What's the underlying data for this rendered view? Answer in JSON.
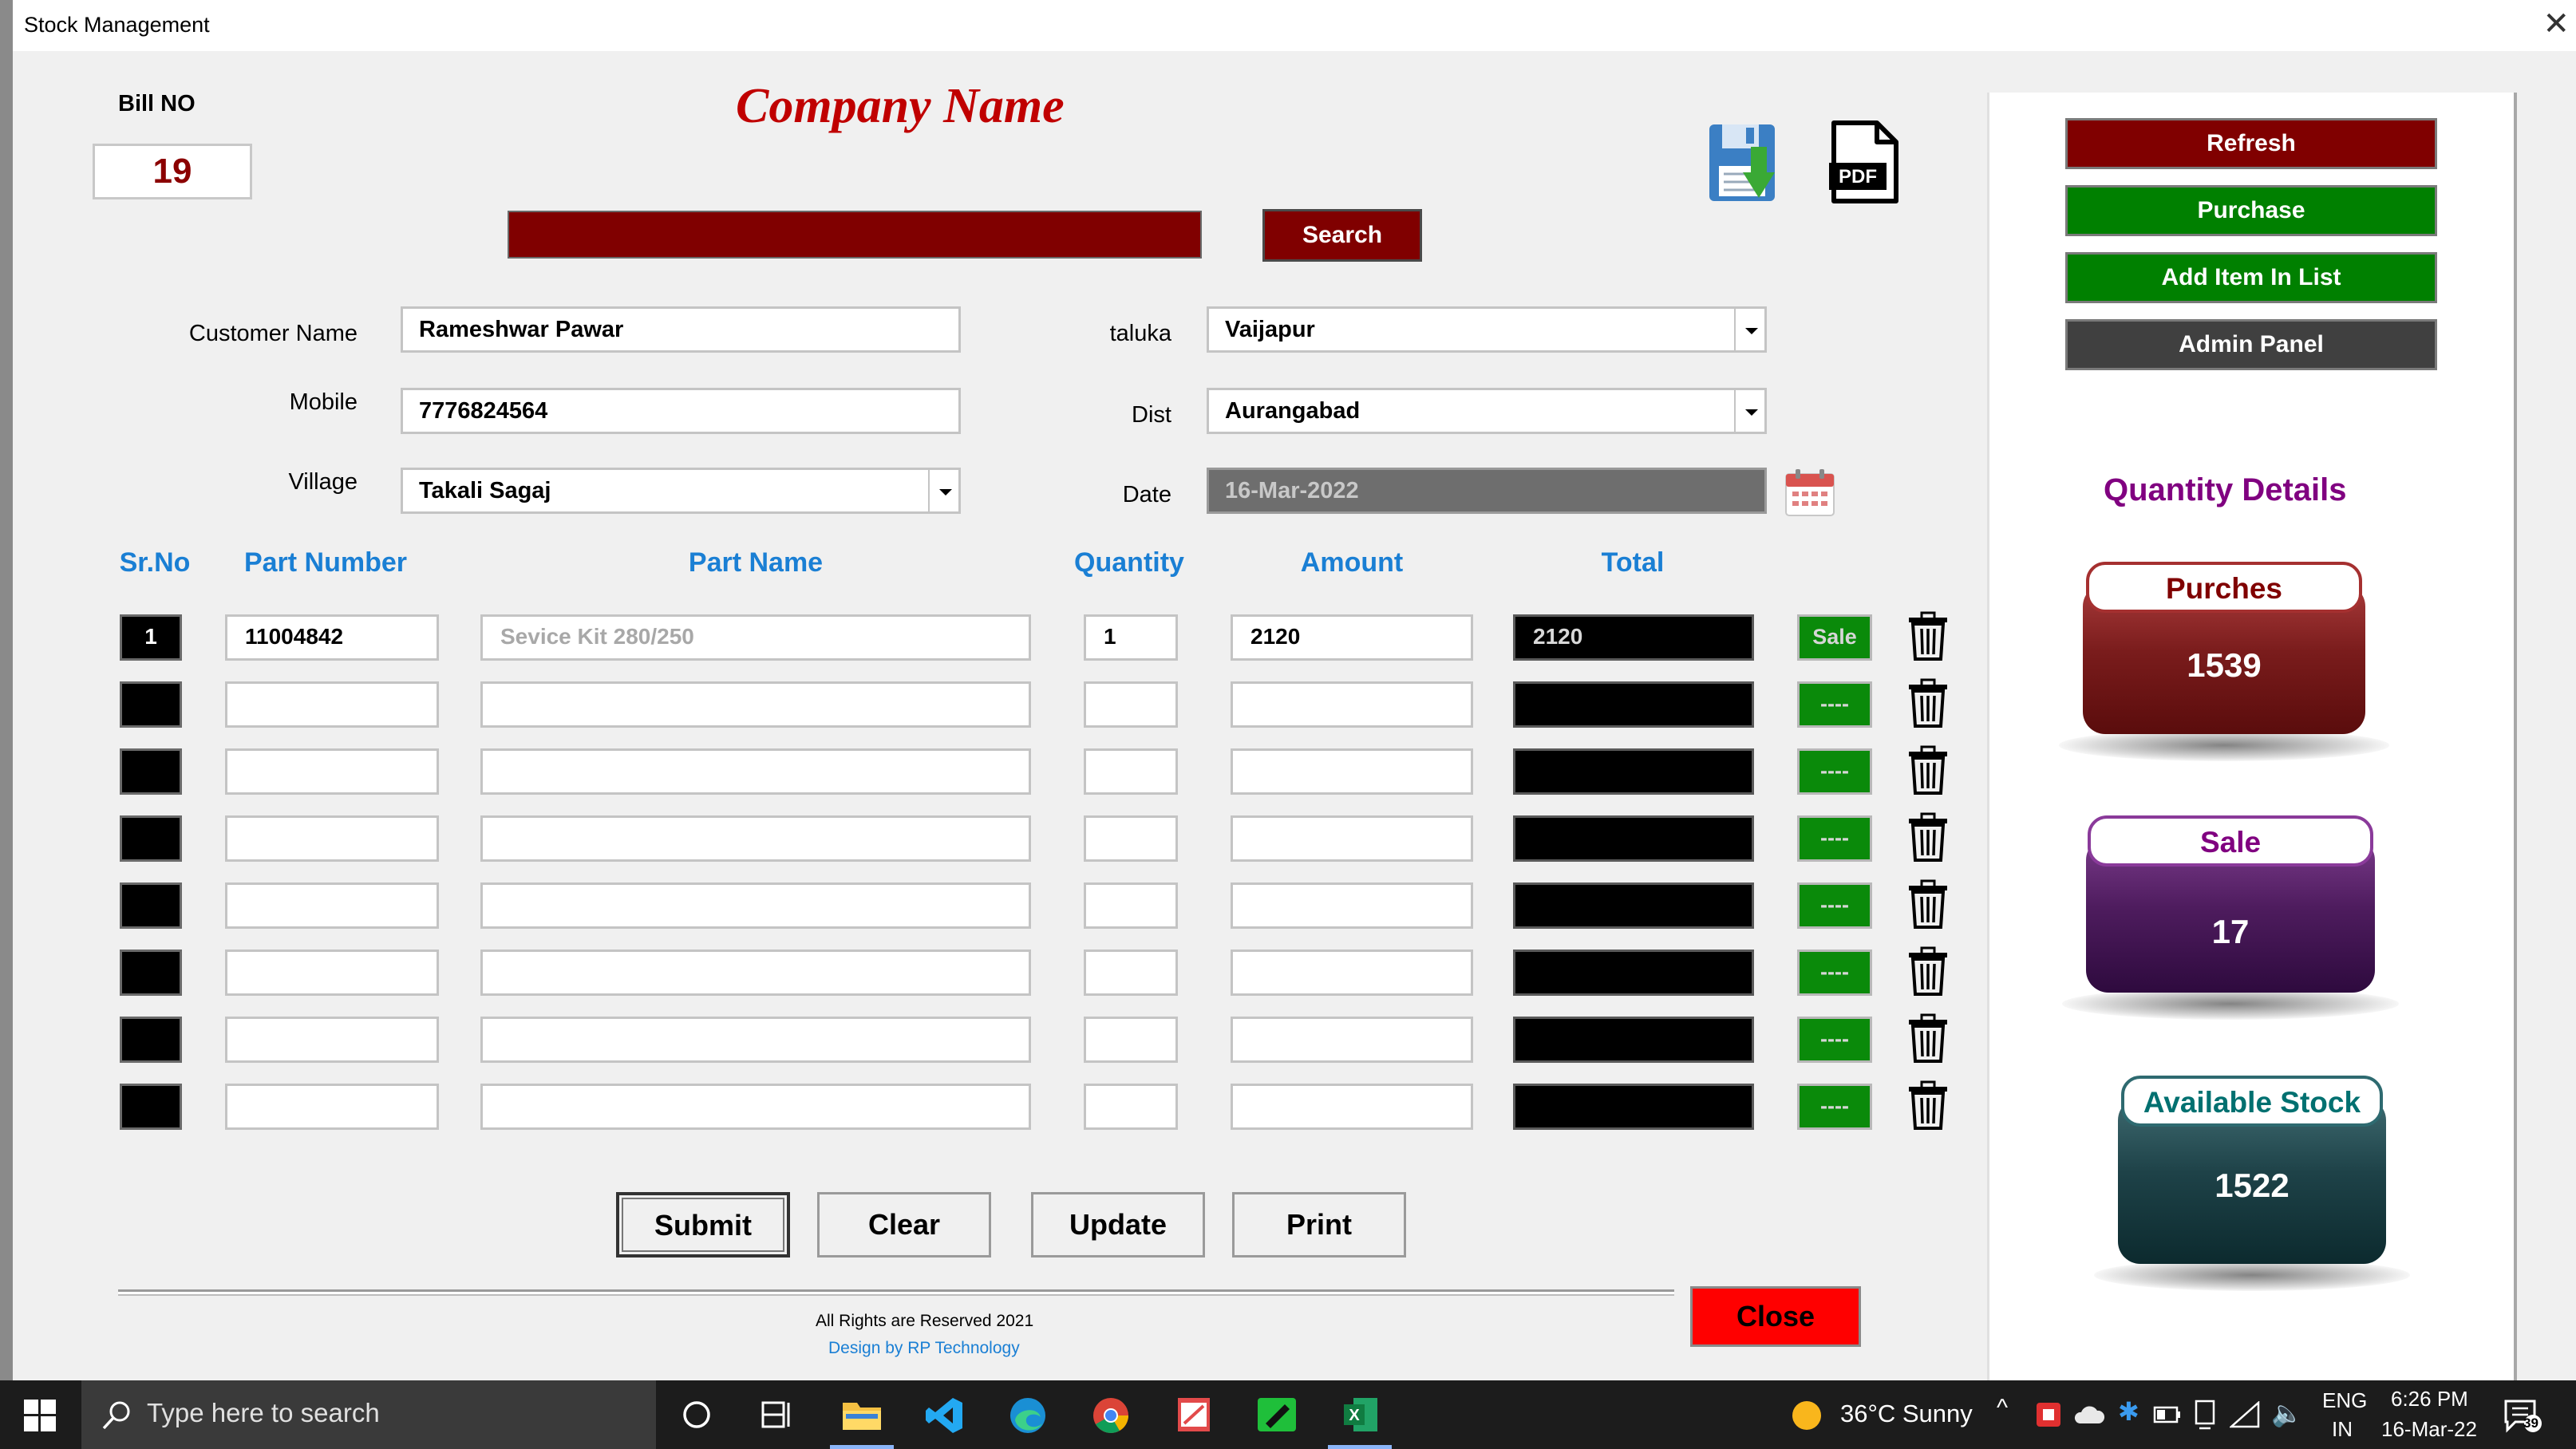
{
  "window": {
    "title": "Stock Management"
  },
  "bill": {
    "label": "Bill NO",
    "number": "19"
  },
  "company_name": "Company Name",
  "search": {
    "button": "Search",
    "value": ""
  },
  "form": {
    "customer_label": "Customer Name",
    "customer_value": "Rameshwar Pawar",
    "mobile_label": "Mobile",
    "mobile_value": "7776824564",
    "village_label": "Village",
    "village_value": "Takali Sagaj",
    "taluka_label": "taluka",
    "taluka_value": "Vaijapur",
    "dist_label": "Dist",
    "dist_value": "Aurangabad",
    "date_label": "Date",
    "date_value": "16-Mar-2022"
  },
  "table": {
    "headers": [
      "Sr.No",
      "Part Number",
      "Part Name",
      "Quantity",
      "Amount",
      "Total"
    ],
    "rows": [
      {
        "sr": "1",
        "part_number": "11004842",
        "part_name": "Sevice Kit 280/250",
        "quantity": "1",
        "amount": "2120",
        "total": "2120",
        "action": "Sale"
      },
      {
        "sr": "",
        "part_number": "",
        "part_name": "",
        "quantity": "",
        "amount": "",
        "total": "",
        "action": "----"
      },
      {
        "sr": "",
        "part_number": "",
        "part_name": "",
        "quantity": "",
        "amount": "",
        "total": "",
        "action": "----"
      },
      {
        "sr": "",
        "part_number": "",
        "part_name": "",
        "quantity": "",
        "amount": "",
        "total": "",
        "action": "----"
      },
      {
        "sr": "",
        "part_number": "",
        "part_name": "",
        "quantity": "",
        "amount": "",
        "total": "",
        "action": "----"
      },
      {
        "sr": "",
        "part_number": "",
        "part_name": "",
        "quantity": "",
        "amount": "",
        "total": "",
        "action": "----"
      },
      {
        "sr": "",
        "part_number": "",
        "part_name": "",
        "quantity": "",
        "amount": "",
        "total": "",
        "action": "----"
      },
      {
        "sr": "",
        "part_number": "",
        "part_name": "",
        "quantity": "",
        "amount": "",
        "total": "",
        "action": "----"
      }
    ]
  },
  "buttons": {
    "submit": "Submit",
    "clear": "Clear",
    "update": "Update",
    "print": "Print",
    "close": "Close"
  },
  "footer": {
    "rights": "All Rights are Reserved 2021",
    "design": "Design by RP Technology"
  },
  "sidebar": {
    "refresh": "Refresh",
    "purchase": "Purchase",
    "add_item": "Add Item In List",
    "admin": "Admin Panel",
    "quantity_title": "Quantity Details",
    "purches_label": "Purches",
    "purches_value": "1539",
    "sale_label": "Sale",
    "sale_value": "17",
    "stock_label": "Available Stock",
    "stock_value": "1522"
  },
  "colors": {
    "dark_red": "#800000",
    "green": "#008000",
    "admin_gray": "#404040",
    "header_blue": "#1a7fd4",
    "quantity_purple": "#800080",
    "close_red": "#ff0000"
  },
  "taskbar": {
    "search_placeholder": "Type here to search",
    "weather": "36°C  Sunny",
    "lang_top": "ENG",
    "lang_bottom": "IN",
    "time": "6:26 PM",
    "date": "16-Mar-22",
    "notifications": "39"
  }
}
